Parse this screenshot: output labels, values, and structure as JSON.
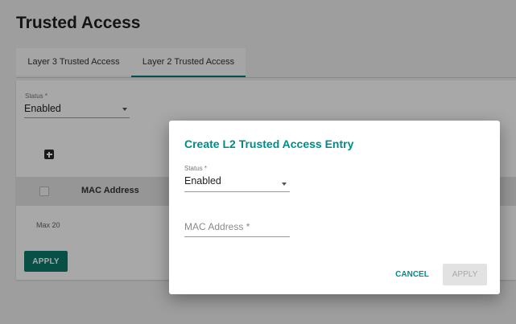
{
  "page": {
    "title": "Trusted Access"
  },
  "tabs": [
    {
      "label": "Layer 3 Trusted Access",
      "active": false
    },
    {
      "label": "Layer 2 Trusted Access",
      "active": true
    }
  ],
  "main": {
    "status_label": "Status *",
    "status_value": "Enabled",
    "table": {
      "columns": [
        "MAC Address"
      ],
      "rows": []
    },
    "max_text": "Max 20",
    "apply_label": "APPLY"
  },
  "dialog": {
    "title": "Create L2 Trusted Access Entry",
    "status_label": "Status *",
    "status_value": "Enabled",
    "mac_placeholder": "MAC Address *",
    "mac_value": "",
    "cancel_label": "CANCEL",
    "apply_label": "APPLY",
    "apply_enabled": false
  },
  "colors": {
    "accent": "#008b8b",
    "primary_button": "#0d7a6a",
    "tab_indicator": "#007a7a"
  },
  "icons": {
    "add": "add-box-icon",
    "dropdown": "chevron-down-icon",
    "checkbox": "checkbox-unchecked-icon"
  }
}
